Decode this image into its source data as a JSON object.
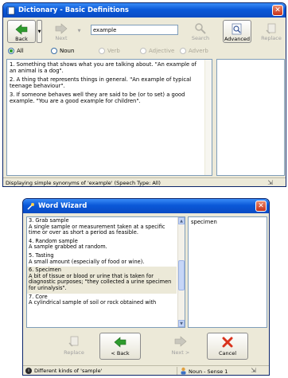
{
  "dictionary": {
    "title": "Dictionary - Basic Definitions",
    "toolbar": {
      "back": "Back",
      "next": "Next",
      "search_value": "example",
      "search": "Search",
      "advanced": "Advanced",
      "replace": "Replace"
    },
    "pos_filters": [
      {
        "label": "All",
        "selected": true,
        "enabled": true
      },
      {
        "label": "Noun",
        "selected": false,
        "enabled": true
      },
      {
        "label": "Verb",
        "selected": false,
        "enabled": false
      },
      {
        "label": "Adjective",
        "selected": false,
        "enabled": false
      },
      {
        "label": "Adverb",
        "selected": false,
        "enabled": false
      }
    ],
    "definitions": [
      "1. Something that shows what you are talking about. \"An example of an animal is a dog\".",
      "2. A thing that represents things in general. \"An example of typical teenage behaviour\".",
      "3. If someone behaves well they are said to be (or to set) a good example. \"You are a good example for children\"."
    ],
    "status": "Displaying simple synonyms of 'example' (Speech Type: All)"
  },
  "word_wizard": {
    "title": "Word Wizard",
    "senses": [
      {
        "head": "3. Grab sample",
        "body": "A single sample or measurement taken at a specific time or over as short a period as feasible.",
        "selected": false
      },
      {
        "head": "4. Random sample",
        "body": "A sample grabbed at random.",
        "selected": false
      },
      {
        "head": "5. Tasting",
        "body": "A small amount (especially of food or wine).",
        "selected": false
      },
      {
        "head": "6. Specimen",
        "body": "A bit of tissue or blood or urine that is taken for diagnostic purposes; \"they collected a urine specimen for urinalysis\".",
        "selected": true
      },
      {
        "head": "7. Core",
        "body": "A cylindrical sample of soil or rock obtained with",
        "selected": false
      }
    ],
    "synonyms": [
      "specimen"
    ],
    "buttons": {
      "replace": "Replace",
      "back": "< Back",
      "next": "Next >",
      "cancel": "Cancel"
    },
    "status_left": "Different kinds of 'sample'",
    "status_right": "Noun - Sense 1"
  },
  "colors": {
    "title_blue": "#0a58d8",
    "window_bg": "#ece9d8",
    "back_arrow_green": "#2e9b2e",
    "cancel_red": "#d9321c"
  }
}
